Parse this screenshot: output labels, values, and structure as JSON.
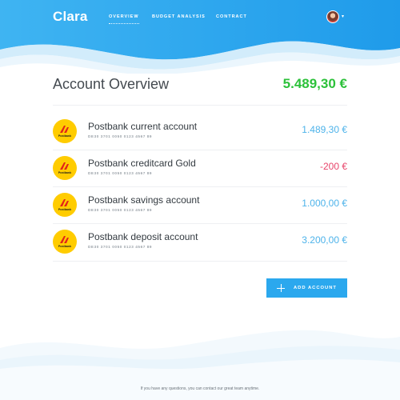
{
  "app": {
    "logo": "Clara"
  },
  "nav": {
    "items": [
      {
        "label": "OVERVIEW",
        "active": true
      },
      {
        "label": "BUDGET ANALYSIS",
        "active": false
      },
      {
        "label": "CONTRACT",
        "active": false
      }
    ]
  },
  "user": {
    "avatar_icon": "user-avatar",
    "menu_icon": "caret-down-icon"
  },
  "overview": {
    "title": "Account Overview",
    "total": "5.489,30 €"
  },
  "accounts": [
    {
      "bank_logo": "Postbank",
      "name": "Postbank current account",
      "iban": "DE30 3701 0050 0123 4567 89",
      "amount": "1.489,30 €",
      "amount_color": "#4db3ea"
    },
    {
      "bank_logo": "Postbank",
      "name": "Postbank creditcard Gold",
      "iban": "DE30 3701 0050 0123 4567 89",
      "amount": "-200 €",
      "amount_color": "#e8456b"
    },
    {
      "bank_logo": "Postbank",
      "name": "Postbank savings account",
      "iban": "DE30 3701 0050 0123 4567 89",
      "amount": "1.000,00 €",
      "amount_color": "#4db3ea"
    },
    {
      "bank_logo": "Postbank",
      "name": "Postbank deposit account",
      "iban": "DE30 3701 0050 0123 4567 89",
      "amount": "3.200,00 €",
      "amount_color": "#4db3ea"
    }
  ],
  "actions": {
    "add_account": "ADD ACCOUNT"
  },
  "footer": {
    "text": "If you have any questions, you can contact our great team anytime."
  },
  "colors": {
    "accent": "#2ba8ee",
    "positive_total": "#2cc13a",
    "negative": "#e8456b"
  }
}
